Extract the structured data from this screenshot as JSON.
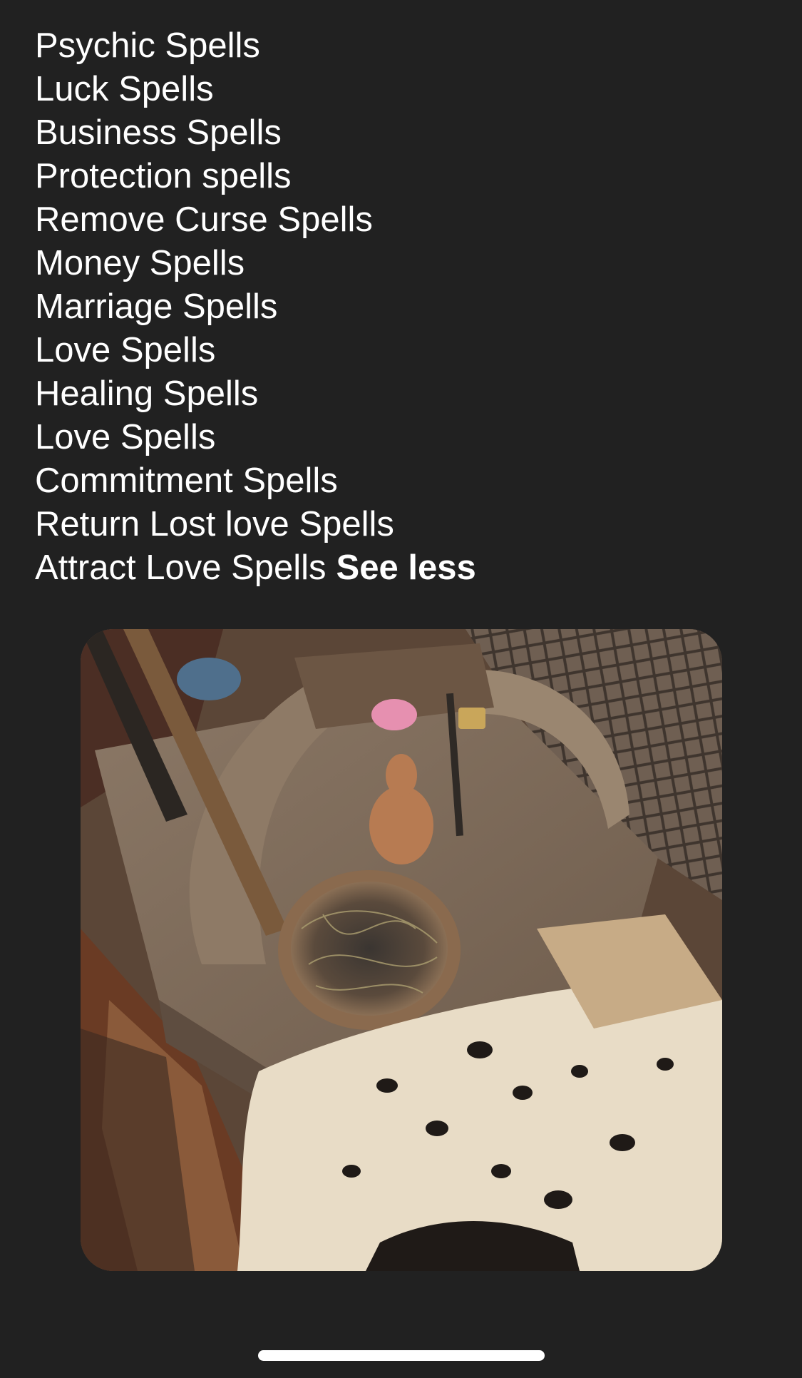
{
  "post": {
    "lines": [
      "Psychic Spells",
      "Luck Spells",
      "Business Spells",
      "Protection spells",
      "Remove Curse Spells",
      "Money Spells",
      "Marriage Spells",
      "Love Spells",
      "Healing Spells",
      "Love Spells",
      "Commitment Spells",
      "Return Lost love Spells",
      "Attract Love Spells"
    ],
    "see_less_label": "See less"
  },
  "colors": {
    "background": "#212121",
    "text": "#ffffff"
  }
}
